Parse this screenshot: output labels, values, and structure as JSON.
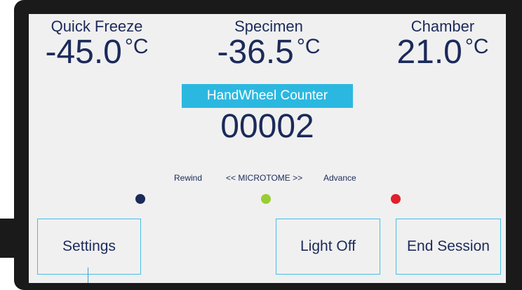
{
  "readouts": {
    "quick_freeze": {
      "label": "Quick Freeze",
      "value": "-45.0",
      "unit": "°C"
    },
    "specimen": {
      "label": "Specimen",
      "value": "-36.5",
      "unit": "°C"
    },
    "chamber": {
      "label": "Chamber",
      "value": "21.0",
      "unit": "°C"
    }
  },
  "handwheel": {
    "label": "HandWheel Counter",
    "value": "00002"
  },
  "microtome": {
    "rewind_label": "Rewind",
    "title": "<< MICROTOME >>",
    "advance_label": "Advance",
    "indicator_colors": {
      "rewind": "#1b2a5a",
      "microtome": "#9acd32",
      "advance": "#e0202a"
    }
  },
  "buttons": {
    "settings": "Settings",
    "light_off": "Light Off",
    "end_session": "End Session"
  },
  "colors": {
    "accent": "#2bb8e0",
    "text": "#1b2a5a",
    "screen_bg": "#f0f0f0",
    "bezel": "#1a1a1a"
  }
}
